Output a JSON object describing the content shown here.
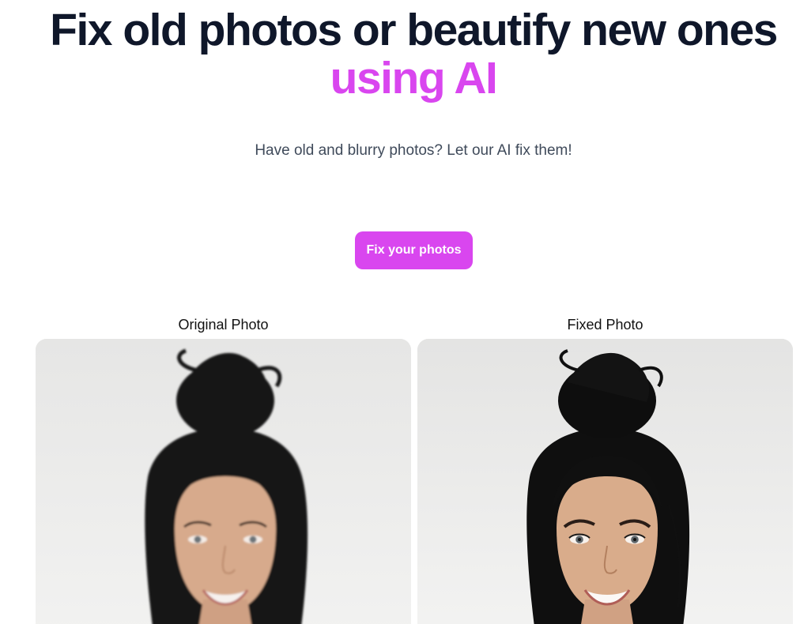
{
  "hero": {
    "title_main": "Fix old photos or beautify new ones ",
    "title_accent": "using AI",
    "subtitle": "Have old and blurry photos? Let our AI fix them!",
    "cta_label": "Fix your photos",
    "accent_color": "#d946ef"
  },
  "comparison": {
    "original_label": "Original Photo",
    "fixed_label": "Fixed Photo"
  }
}
